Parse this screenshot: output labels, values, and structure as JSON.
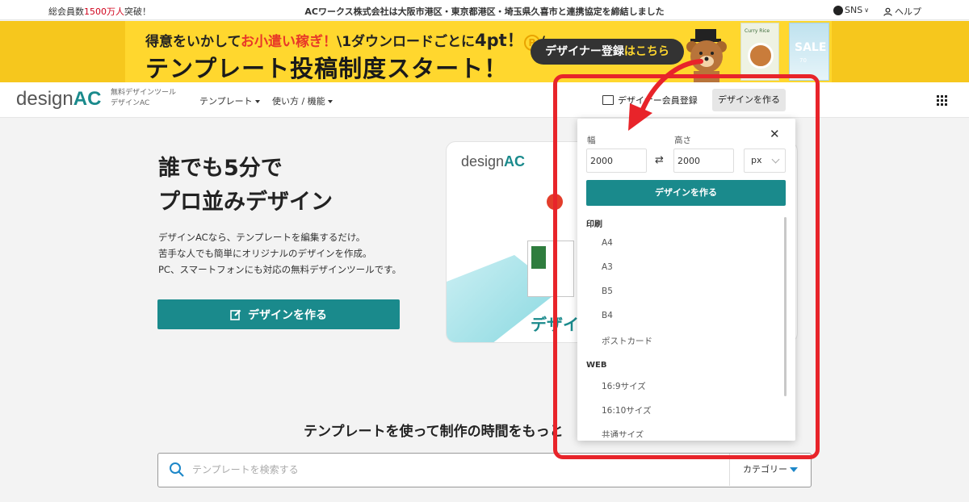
{
  "topbar": {
    "members_prefix": "総会員数",
    "members_count": "1500万人",
    "members_suffix": "突破！",
    "announcement": "ACワークス株式会社は大阪市港区・東京都港区・埼玉県久喜市と連携協定を締結しました",
    "sns": "SNS",
    "help": "ヘルプ"
  },
  "banner": {
    "line1_a": "得意をいかして",
    "line1_red": "お小遣い稼ぎ！",
    "line1_b": "\\1ダウンロードごとに",
    "line1_pt": "4pt！",
    "line1_circle": "P",
    "line1_tail": "/",
    "line2": "テンプレート投稿制度スタート！",
    "register_a": "デザイナー登録",
    "register_b": "はこちら",
    "thumb1_text": "Curry Rice",
    "thumb2_text": "SALE",
    "thumb2_sub": "70"
  },
  "header": {
    "logo_design": "design",
    "logo_ac": "AC",
    "tagline_1": "無料デザインツール",
    "tagline_2": "デザインAC",
    "nav_templates": "テンプレート",
    "nav_usage": "使い方 / 機能",
    "designer_register": "デザイナー会員登録",
    "create_design": "デザインを作る"
  },
  "hero": {
    "title_1": "誰でも5分で",
    "title_2": "プロ並みデザイン",
    "desc_1": "デザインACなら、テンプレートを編集するだけ。",
    "desc_2": "苦手な人でも簡単にオリジナルのデザインを作成。",
    "desc_3": "PC、スマートフォンにも対応の無料デザインツールです。",
    "button": "デザインを作る",
    "card_logo_design": "design",
    "card_logo_ac": "AC",
    "card_text": "デザイ"
  },
  "dropdown": {
    "width_label": "幅",
    "height_label": "高さ",
    "width_value": "2000",
    "height_value": "2000",
    "swap": "⇄",
    "unit": "px",
    "close": "✕",
    "create_button": "デザインを作る",
    "categories": [
      {
        "name": "印刷",
        "items": [
          "A4",
          "A3",
          "B5",
          "B4",
          "ポストカード"
        ]
      },
      {
        "name": "WEB",
        "items": [
          "16:9サイズ",
          "16:10サイズ",
          "共通サイズ"
        ]
      }
    ]
  },
  "bottom": {
    "subtitle": "テンプレートを使って制作の時間をもっと",
    "search_placeholder": "テンプレートを検索する",
    "category_label": "カテゴリー"
  },
  "colors": {
    "brand_teal": "#1a8a8c",
    "banner_yellow": "#ffd72e",
    "annotation_red": "#e8242a"
  }
}
